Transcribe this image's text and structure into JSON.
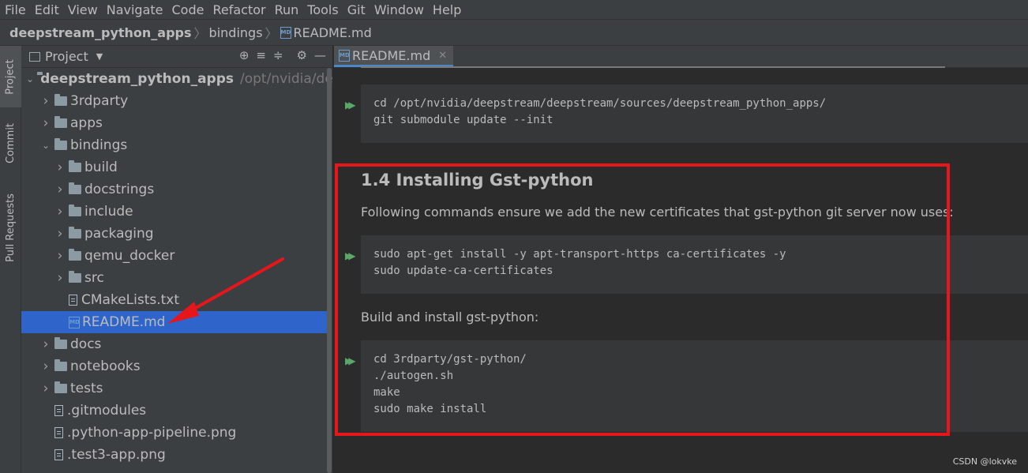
{
  "menu": [
    "File",
    "Edit",
    "View",
    "Navigate",
    "Code",
    "Refactor",
    "Run",
    "Tools",
    "Git",
    "Window",
    "Help"
  ],
  "breadcrumb": {
    "project": "deepstream_python_apps",
    "folder": "bindings",
    "file": "README.md",
    "file_icon": "MD"
  },
  "left_tabs": [
    "Project",
    "Commit",
    "Pull Requests"
  ],
  "project_panel": {
    "title": "Project",
    "tool_icons": [
      "crosshair-icon",
      "expand-all-icon",
      "collapse-all-icon",
      "gear-icon",
      "minimize-icon"
    ]
  },
  "tree": [
    {
      "label": "deepstream_python_apps",
      "path": "/opt/nvidia/deepst",
      "type": "folder",
      "expanded": true,
      "depth": 0
    },
    {
      "label": "3rdparty",
      "type": "folder",
      "depth": 1
    },
    {
      "label": "apps",
      "type": "folder",
      "depth": 1
    },
    {
      "label": "bindings",
      "type": "folder",
      "expanded": true,
      "depth": 1
    },
    {
      "label": "build",
      "type": "folder",
      "depth": 2
    },
    {
      "label": "docstrings",
      "type": "folder",
      "depth": 2
    },
    {
      "label": "include",
      "type": "folder",
      "depth": 2
    },
    {
      "label": "packaging",
      "type": "folder",
      "depth": 2
    },
    {
      "label": "qemu_docker",
      "type": "folder",
      "depth": 2
    },
    {
      "label": "src",
      "type": "folder",
      "depth": 2
    },
    {
      "label": "CMakeLists.txt",
      "type": "file",
      "depth": 2
    },
    {
      "label": "README.md",
      "type": "md",
      "depth": 2,
      "selected": true
    },
    {
      "label": "docs",
      "type": "folder",
      "depth": 1
    },
    {
      "label": "notebooks",
      "type": "folder",
      "depth": 1
    },
    {
      "label": "tests",
      "type": "folder",
      "depth": 1
    },
    {
      "label": ".gitmodules",
      "type": "file",
      "depth": 1
    },
    {
      "label": ".python-app-pipeline.png",
      "type": "file",
      "depth": 1
    },
    {
      "label": ".test3-app.png",
      "type": "file",
      "depth": 1
    }
  ],
  "editor": {
    "tab_label": "README.md",
    "code1": "cd /opt/nvidia/deepstream/deepstream/sources/deepstream_python_apps/\ngit submodule update --init",
    "heading": "1.4 Installing Gst-python",
    "para1": "Following commands ensure we add the new certificates that gst-python git server now uses:",
    "code2": "sudo apt-get install -y apt-transport-https ca-certificates -y\nsudo update-ca-certificates",
    "para2": "Build and install gst-python:",
    "code3": "cd 3rdparty/gst-python/\n./autogen.sh\nmake\nsudo make install"
  },
  "watermark": "CSDN @lokvke",
  "colors": {
    "highlight": "#e6161b",
    "selection": "#2f65ca",
    "run_icon": "#59a869"
  }
}
